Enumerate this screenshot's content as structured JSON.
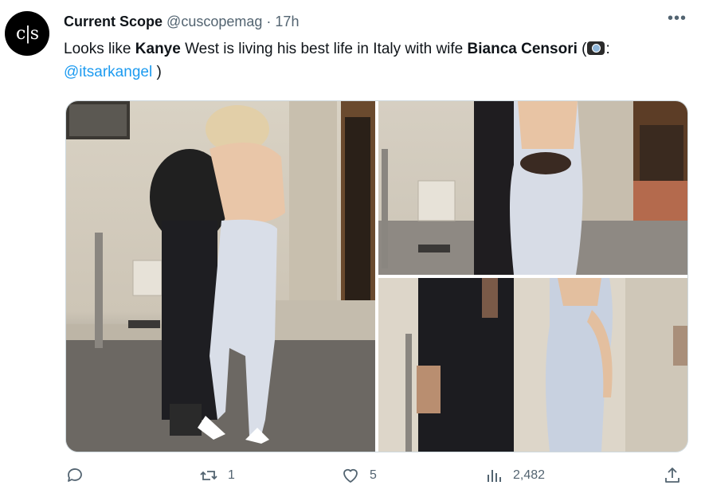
{
  "tweet": {
    "avatar_text": "c|s",
    "author_name": "Current Scope",
    "handle": "@cuscopemag",
    "separator": "·",
    "time": "17h",
    "more_icon": "more-horizontal-icon",
    "text": {
      "part1": "Looks like ",
      "bold1": "Kanye",
      "part2": " West is living his best life in Italy with wife ",
      "bold2": "Bianca Censori",
      "part3": " (",
      "emoji": "camera-flash-emoji",
      "part4": ": ",
      "mention": "@itsarkangel",
      "part5": " )"
    }
  },
  "media": {
    "photo_count": 3
  },
  "actions": {
    "reply": {
      "icon": "reply-icon",
      "count": ""
    },
    "retweet": {
      "icon": "retweet-icon",
      "count": "1"
    },
    "like": {
      "icon": "heart-icon",
      "count": "5"
    },
    "views": {
      "icon": "views-chart-icon",
      "count": "2,482"
    },
    "share": {
      "icon": "share-icon",
      "count": ""
    }
  },
  "colors": {
    "link": "#1d9bf0",
    "muted": "#536471",
    "text": "#0f1419"
  }
}
